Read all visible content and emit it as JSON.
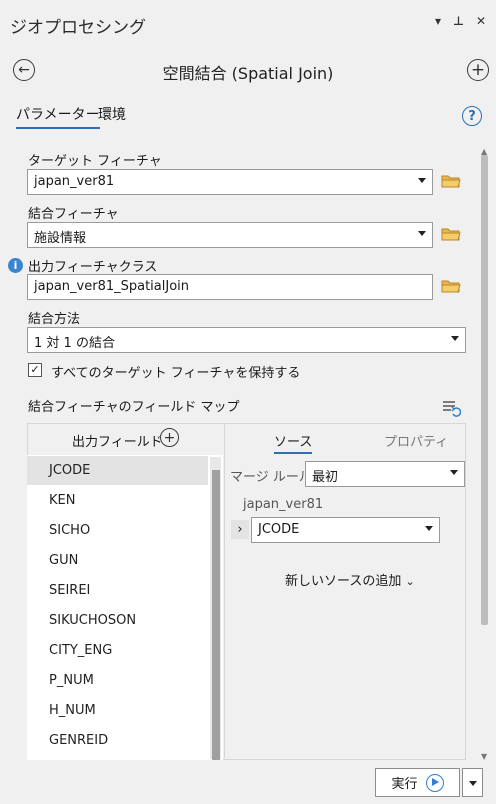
{
  "pane": {
    "title": "ジオプロセシング",
    "ctrl_dropdown": "▾",
    "ctrl_pin": "ᵽ",
    "ctrl_close": "✕"
  },
  "tool": {
    "title": "空間結合 (Spatial Join)"
  },
  "tabs": [
    {
      "label": "パラメーター"
    },
    {
      "label": "環境"
    }
  ],
  "params": {
    "target": {
      "label": "ターゲット フィーチャ",
      "value": "japan_ver81"
    },
    "join": {
      "label": "結合フィーチャ",
      "value": "施設情報"
    },
    "output": {
      "label": "出力フィーチャクラス",
      "value": "japan_ver81_SpatialJoin"
    },
    "method": {
      "label": "結合方法",
      "value": "1 対 1 の結合"
    },
    "keep_all": {
      "label": "すべてのターゲット フィーチャを保持する",
      "checked": true
    }
  },
  "field_map": {
    "label": "結合フィーチャのフィールド マップ",
    "output_fields_label": "出力フィールド",
    "fields": [
      "JCODE",
      "KEN",
      "SICHO",
      "GUN",
      "SEIREI",
      "SIKUCHOSON",
      "CITY_ENG",
      "P_NUM",
      "H_NUM",
      "GENREID"
    ],
    "tabs": [
      {
        "label": "ソース"
      },
      {
        "label": "プロパティ"
      }
    ],
    "merge_rule_label": "マージ ルール",
    "merge_rule_value": "最初",
    "source_layer": "japan_ver81",
    "source_field": "JCODE",
    "add_source_label": "新しいソースの追加"
  },
  "run": {
    "label": "実行"
  },
  "colors": {
    "accent": "#2e6fb8",
    "folder": "#e8b64a"
  }
}
